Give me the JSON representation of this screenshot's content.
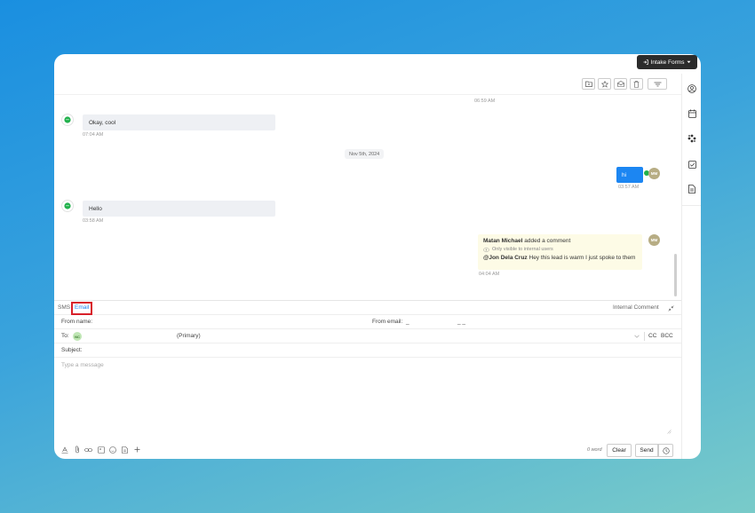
{
  "header": {
    "intake_label": "Intake Forms"
  },
  "toolbar": {
    "icons": [
      "folder-icon",
      "star-icon",
      "mail-open-icon",
      "trash-icon",
      "filter-icon"
    ]
  },
  "rail": {
    "icons": [
      "user-circle-icon",
      "calendar-icon",
      "apps-icon",
      "checkbox-icon",
      "document-icon"
    ]
  },
  "conversation": {
    "top_time": "06:59 AM",
    "msg1": {
      "text": "Okay, cool",
      "time": "07:04 AM"
    },
    "date_divider": "Nov 5th, 2024",
    "msg2": {
      "text": "hi",
      "time": "03:57 AM",
      "avatar": "MM"
    },
    "msg3": {
      "text": "Hello",
      "time": "03:58 AM"
    },
    "comment": {
      "author": "Matan Michael",
      "action": "added a comment",
      "visibility": "Only visible to internal users",
      "mention": "@Jon Dela Cruz",
      "text": "Hey this lead is warm I just spoke to them",
      "time": "04:04 AM",
      "avatar": "MM"
    }
  },
  "compose": {
    "tabs": {
      "sms": "SMS",
      "email": "Email"
    },
    "internal_comment": "Internal Comment",
    "from_name_label": "From name:",
    "from_email_label": "From email:",
    "from_email_value": "_",
    "from_email_value2": "_ _",
    "to_label": "To:",
    "to_badge": "NC",
    "to_primary": "(Primary)",
    "cc": "CC",
    "bcc": "BCC",
    "subject_label": "Subject:",
    "message_placeholder": "Type a message",
    "word_count": "0 word",
    "clear": "Clear",
    "send": "Send"
  },
  "colors": {
    "accent": "#1c86f2",
    "highlight": "#d8202a",
    "sms_green": "#22b14c"
  }
}
